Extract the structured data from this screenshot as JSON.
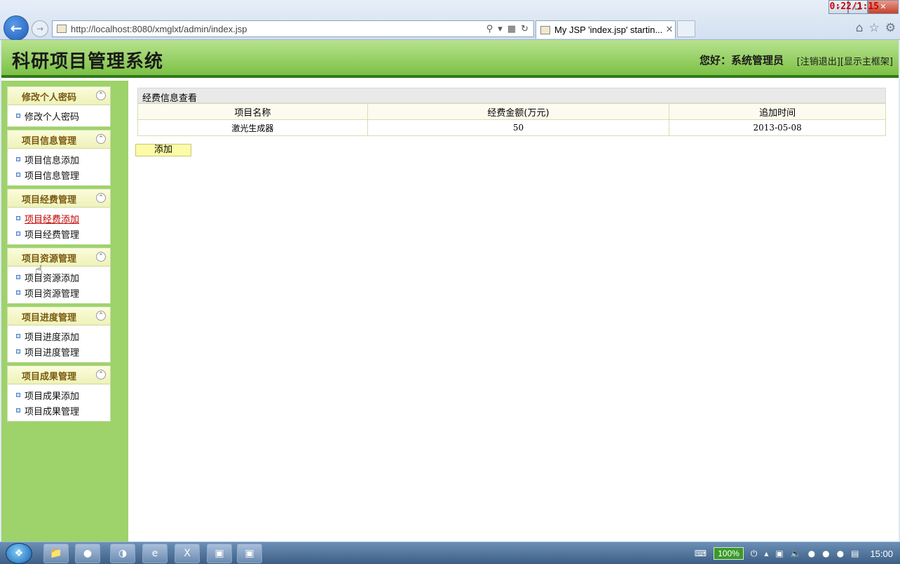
{
  "browser": {
    "url": "http://localhost:8080/xmglxt/admin/index.jsp",
    "tab_title": "My JSP 'index.jsp' startin...",
    "timer": "0:22/1:15"
  },
  "header": {
    "site_title": "科研项目管理系统",
    "welcome": "您好：系统管理员",
    "logout": "[注销退出]",
    "show_frame": "[显示主框架]"
  },
  "sidebar": {
    "groups": [
      {
        "title": "修改个人密码",
        "items": [
          "修改个人密码"
        ]
      },
      {
        "title": "项目信息管理",
        "items": [
          "项目信息添加",
          "项目信息管理"
        ]
      },
      {
        "title": "项目经费管理",
        "items": [
          "项目经费添加",
          "项目经费管理"
        ]
      },
      {
        "title": "项目资源管理",
        "items": [
          "项目资源添加",
          "项目资源管理"
        ]
      },
      {
        "title": "项目进度管理",
        "items": [
          "项目进度添加",
          "项目进度管理"
        ]
      },
      {
        "title": "项目成果管理",
        "items": [
          "项目成果添加",
          "项目成果管理"
        ]
      }
    ]
  },
  "content": {
    "panel_title": "经费信息查看",
    "columns": [
      "项目名称",
      "经费金额(万元)",
      "追加时间"
    ],
    "rows": [
      [
        "激光生成器",
        "50",
        "2013-05-08"
      ]
    ],
    "add_button": "添加"
  },
  "taskbar": {
    "battery": "100%",
    "clock": "15:00"
  }
}
